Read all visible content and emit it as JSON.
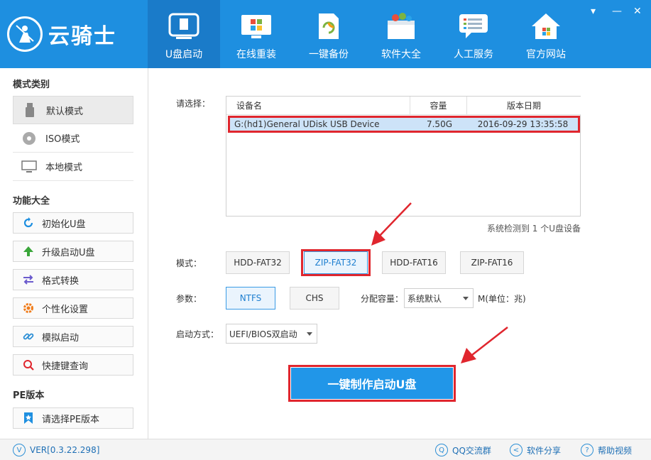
{
  "app": {
    "title": "云骑士"
  },
  "window": {
    "minimize": "▾",
    "restore": "—",
    "close": "✕"
  },
  "nav": [
    {
      "label": "U盘启动",
      "icon": "usb-drive-icon",
      "active": true
    },
    {
      "label": "在线重装",
      "icon": "windows-monitor-icon",
      "active": false
    },
    {
      "label": "一键备份",
      "icon": "backup-document-icon",
      "active": false
    },
    {
      "label": "软件大全",
      "icon": "software-box-icon",
      "active": false
    },
    {
      "label": "人工服务",
      "icon": "chat-service-icon",
      "active": false
    },
    {
      "label": "官方网站",
      "icon": "home-icon",
      "active": false
    }
  ],
  "sidebar": {
    "mode_heading": "模式类别",
    "modes": [
      {
        "label": "默认模式",
        "icon": "usb-stick-icon"
      },
      {
        "label": "ISO模式",
        "icon": "disc-icon"
      },
      {
        "label": "本地模式",
        "icon": "monitor-icon"
      }
    ],
    "func_heading": "功能大全",
    "functions": [
      {
        "label": "初始化U盘",
        "icon": "refresh-icon"
      },
      {
        "label": "升级启动U盘",
        "icon": "upgrade-arrow-icon"
      },
      {
        "label": "格式转换",
        "icon": "convert-arrows-icon"
      },
      {
        "label": "个性化设置",
        "icon": "gear-icon"
      },
      {
        "label": "模拟启动",
        "icon": "link-icon"
      },
      {
        "label": "快捷键查询",
        "icon": "search-icon"
      }
    ],
    "pe_heading": "PE版本",
    "pe_button": {
      "label": "请选择PE版本",
      "icon": "bookmark-icon"
    }
  },
  "main": {
    "select_label": "请选择：",
    "table": {
      "headers": [
        "设备名",
        "容量",
        "版本日期"
      ],
      "rows": [
        {
          "name": "G:(hd1)General UDisk USB Device",
          "capacity": "7.50G",
          "date": "2016-09-29 13:35:58"
        }
      ]
    },
    "status": "系统检测到 1 个U盘设备",
    "mode_label": "模式：",
    "modes": [
      "HDD-FAT32",
      "ZIP-FAT32",
      "HDD-FAT16",
      "ZIP-FAT16"
    ],
    "selected_mode": "ZIP-FAT32",
    "param_label": "参数：",
    "params": [
      "NTFS",
      "CHS"
    ],
    "selected_param": "NTFS",
    "alloc_label": "分配容量：",
    "alloc_value": "系统默认",
    "alloc_unit": "M(单位：兆)",
    "boot_label": "启动方式：",
    "boot_value": "UEFI/BIOS双启动",
    "make_button": "一键制作启动U盘"
  },
  "footer": {
    "version": "VER[0.3.22.298]",
    "qq": "QQ交流群",
    "share": "软件分享",
    "help": "帮助视频"
  },
  "colors": {
    "brand": "#1e8fe0",
    "accent": "#2196e8",
    "highlight": "#e0262e"
  }
}
